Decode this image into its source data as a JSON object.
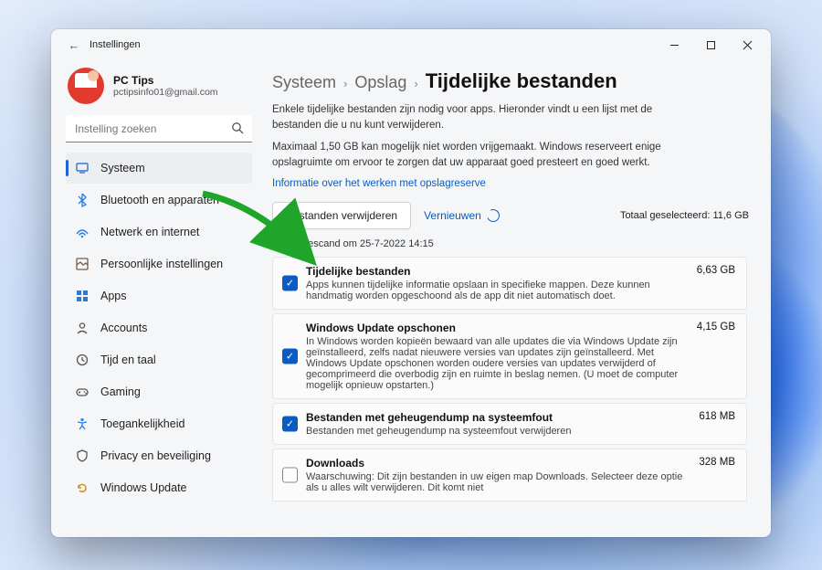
{
  "window": {
    "app_title": "Instellingen"
  },
  "profile": {
    "name": "PC Tips",
    "email": "pctipsinfo01@gmail.com"
  },
  "search": {
    "placeholder": "Instelling zoeken"
  },
  "sidebar": {
    "items": [
      {
        "icon": "system",
        "label": "Systeem",
        "selected": true
      },
      {
        "icon": "bluetooth",
        "label": "Bluetooth en apparaten"
      },
      {
        "icon": "network",
        "label": "Netwerk en internet"
      },
      {
        "icon": "personal",
        "label": "Persoonlijke instellingen"
      },
      {
        "icon": "apps",
        "label": "Apps"
      },
      {
        "icon": "accounts",
        "label": "Accounts"
      },
      {
        "icon": "time",
        "label": "Tijd en taal"
      },
      {
        "icon": "gaming",
        "label": "Gaming"
      },
      {
        "icon": "access",
        "label": "Toegankelijkheid"
      },
      {
        "icon": "privacy",
        "label": "Privacy en beveiliging"
      },
      {
        "icon": "update",
        "label": "Windows Update"
      }
    ]
  },
  "breadcrumb": {
    "a": "Systeem",
    "b": "Opslag",
    "c": "Tijdelijke bestanden"
  },
  "intro": {
    "p1": "Enkele tijdelijke bestanden zijn nodig voor apps. Hieronder vindt u een lijst met de bestanden die u nu kunt verwijderen.",
    "p2": "Maximaal 1,50 GB kan mogelijk niet worden vrijgemaakt. Windows reserveert enige opslagruimte om ervoor te zorgen dat uw apparaat goed presteert en goed werkt.",
    "link": "Informatie over het werken met opslagreserve"
  },
  "actions": {
    "delete": "Bestanden verwijderen",
    "refresh": "Vernieuwen",
    "total_label": "Totaal geselecteerd: 11,6 GB"
  },
  "scan": "Laatst gescand om 25-7-2022 14:15",
  "items": [
    {
      "title": "Tijdelijke bestanden",
      "size": "6,63 GB",
      "checked": true,
      "desc": "Apps kunnen tijdelijke informatie opslaan in specifieke mappen. Deze kunnen handmatig worden opgeschoond als de app dit niet automatisch doet."
    },
    {
      "title": "Windows Update opschonen",
      "size": "4,15 GB",
      "checked": true,
      "desc": "In Windows worden kopieën bewaard van alle updates die via Windows Update zijn geïnstalleerd, zelfs nadat nieuwere versies van updates zijn geïnstalleerd. Met Windows Update opschonen worden oudere versies van updates verwijderd of gecomprimeerd die overbodig zijn en ruimte in beslag nemen. (U moet de computer mogelijk opnieuw opstarten.)"
    },
    {
      "title": "Bestanden met geheugendump na systeemfout",
      "size": "618 MB",
      "checked": true,
      "desc": "Bestanden met geheugendump na systeemfout verwijderen"
    },
    {
      "title": "Downloads",
      "size": "328 MB",
      "checked": false,
      "desc": "Waarschuwing: Dit zijn bestanden in uw eigen map Downloads. Selecteer deze optie als u alles wilt verwijderen. Dit komt niet"
    }
  ]
}
